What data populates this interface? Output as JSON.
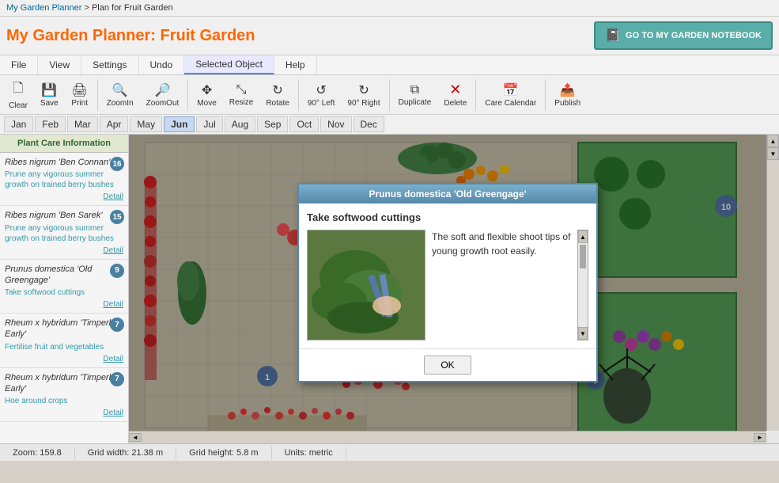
{
  "breadcrumb": {
    "link_text": "My Garden Planner",
    "separator": " > ",
    "page": "Plan for Fruit Garden"
  },
  "title": {
    "prefix": "My Garden Planner: ",
    "name": "Fruit Garden"
  },
  "notebook_button": "GO TO MY GARDEN NOTEBOOK",
  "menu": {
    "items": [
      "File",
      "View",
      "Settings",
      "Undo",
      "Selected Object",
      "Help"
    ]
  },
  "toolbar": {
    "buttons": [
      {
        "label": "Clear",
        "icon": "🗋"
      },
      {
        "label": "Save",
        "icon": "💾"
      },
      {
        "label": "Print",
        "icon": "🖨"
      },
      {
        "label": "ZoomIn",
        "icon": "🔍+"
      },
      {
        "label": "ZoomOut",
        "icon": "🔍-"
      },
      {
        "label": "Move",
        "icon": "✥"
      },
      {
        "label": "Resize",
        "icon": "⤡"
      },
      {
        "label": "Rotate",
        "icon": "↻"
      },
      {
        "label": "90° Left",
        "icon": "↺"
      },
      {
        "label": "90° Right",
        "icon": "↻"
      },
      {
        "label": "Duplicate",
        "icon": "⧉"
      },
      {
        "label": "Delete",
        "icon": "✕"
      },
      {
        "label": "Care Calendar",
        "icon": "📅"
      },
      {
        "label": "Publish",
        "icon": "📤"
      }
    ]
  },
  "months": {
    "items": [
      "Jan",
      "Feb",
      "Mar",
      "Apr",
      "May",
      "Jun",
      "Jul",
      "Aug",
      "Sep",
      "Oct",
      "Nov",
      "Dec"
    ],
    "active": "Jun"
  },
  "panel": {
    "title": "Plant Care Information",
    "plants": [
      {
        "name": "Ribes nigrum 'Ben Connan'",
        "badge": "16",
        "care": "Prune any vigorous summer growth on trained berry bushes",
        "detail": "Detail"
      },
      {
        "name": "Ribes nigrum 'Ben Sarek'",
        "badge": "15",
        "care": "Prune any vigorous summer growth on trained berry bushes",
        "detail": "Detail"
      },
      {
        "name": "Prunus domestica 'Old Greengage'",
        "badge": "9",
        "care": "Take softwood cuttings",
        "detail": "Detail"
      },
      {
        "name": "Rheum x hybridum 'Timperley Early'",
        "badge": "7",
        "care": "Fertilise fruit and vegetables",
        "detail": "Detail"
      },
      {
        "name": "Rheum x hybridum 'Timperley Early'",
        "badge": "7",
        "care": "Hoe around crops",
        "detail": "Detail"
      }
    ]
  },
  "modal": {
    "title": "Prunus domestica 'Old Greengage'",
    "care_title": "Take softwood cuttings",
    "text": "The soft and flexible shoot tips of young growth root easily.",
    "ok_label": "OK"
  },
  "status": {
    "zoom": "Zoom: 159.8",
    "grid_width": "Grid width: 21.38 m",
    "grid_height": "Grid height: 5.8 m",
    "units": "Units: metric"
  }
}
